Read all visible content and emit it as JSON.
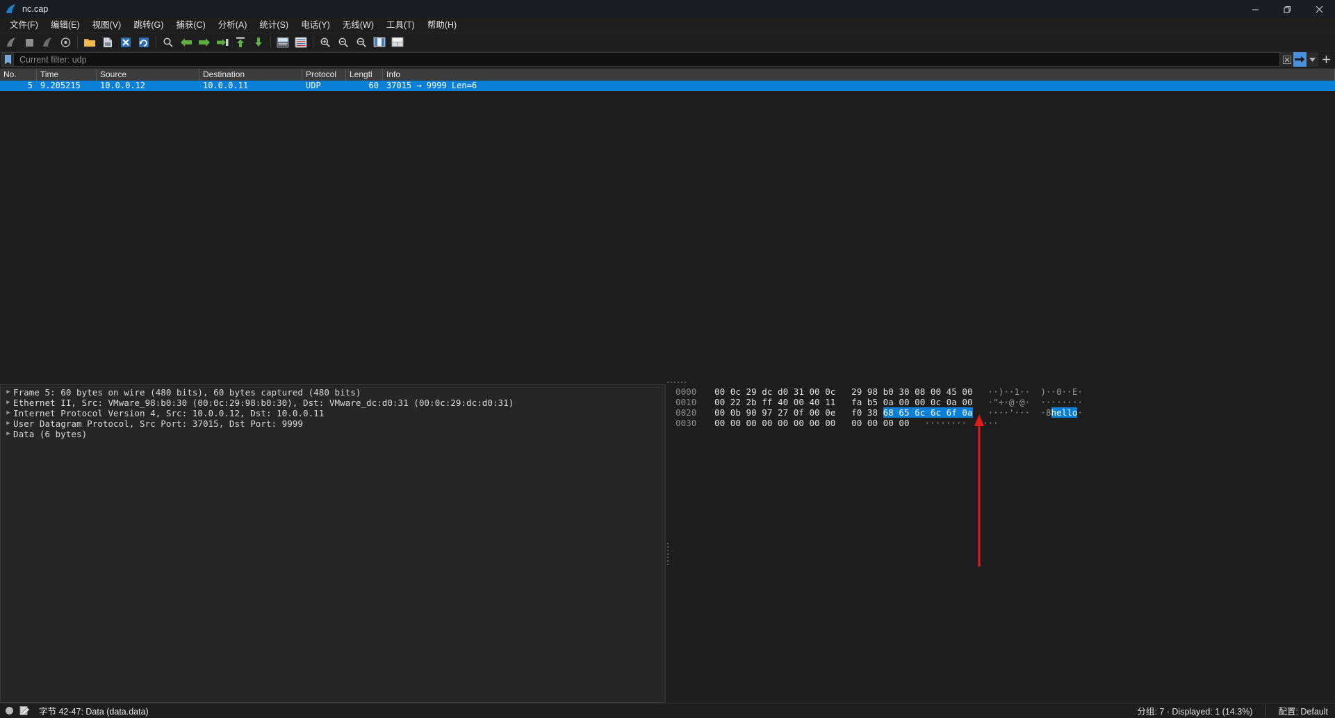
{
  "window": {
    "title": "nc.cap",
    "app_icon": "wireshark-fin-icon",
    "controls": {
      "minimize": "minimize-icon",
      "maximize": "restore-icon",
      "close": "close-icon"
    }
  },
  "menubar": {
    "items": [
      {
        "label": "文件(F)",
        "mnemonic": "F"
      },
      {
        "label": "编辑(E)",
        "mnemonic": "E"
      },
      {
        "label": "视图(V)",
        "mnemonic": "V"
      },
      {
        "label": "跳转(G)",
        "mnemonic": "G"
      },
      {
        "label": "捕获(C)",
        "mnemonic": "C"
      },
      {
        "label": "分析(A)",
        "mnemonic": "A"
      },
      {
        "label": "统计(S)",
        "mnemonic": "S"
      },
      {
        "label": "电话(Y)",
        "mnemonic": "Y"
      },
      {
        "label": "无线(W)",
        "mnemonic": "W"
      },
      {
        "label": "工具(T)",
        "mnemonic": "T"
      },
      {
        "label": "帮助(H)",
        "mnemonic": "H"
      }
    ]
  },
  "toolbar": {
    "buttons": [
      "start-capture-icon",
      "stop-capture-icon",
      "restart-capture-icon",
      "capture-options-icon",
      "open-file-icon",
      "save-file-icon",
      "close-file-icon",
      "reload-file-icon",
      "find-packet-icon",
      "go-back-icon",
      "go-forward-icon",
      "go-to-packet-icon",
      "go-to-first-icon",
      "go-to-last-icon",
      "colorize-icon",
      "auto-scroll-icon",
      "zoom-in-icon",
      "zoom-out-icon",
      "zoom-reset-icon",
      "resize-columns-icon",
      "layout-icon"
    ]
  },
  "filter": {
    "bookmark_icon": "filter-bookmark-icon",
    "value": "",
    "placeholder": "Current filter: udp",
    "clear_icon": "clear-filter-icon",
    "apply_icon": "apply-filter-icon",
    "history_icon": "filter-history-caret-icon",
    "add_icon": "add-filter-button-icon"
  },
  "packet_list": {
    "columns": [
      {
        "key": "no",
        "label": "No."
      },
      {
        "key": "time",
        "label": "Time"
      },
      {
        "key": "source",
        "label": "Source"
      },
      {
        "key": "destination",
        "label": "Destination"
      },
      {
        "key": "protocol",
        "label": "Protocol"
      },
      {
        "key": "length",
        "label": "Lengtl"
      },
      {
        "key": "info",
        "label": "Info"
      }
    ],
    "rows": [
      {
        "no": "5",
        "time": "9.205215",
        "source": "10.0.0.12",
        "destination": "10.0.0.11",
        "protocol": "UDP",
        "length": "60",
        "info": "37015 → 9999  Len=6",
        "selected": true
      }
    ]
  },
  "detail_tree": {
    "rows": [
      {
        "arrow": "collapsed-triangle-icon",
        "text": "Frame 5: 60 bytes on wire (480 bits), 60 bytes captured (480 bits)"
      },
      {
        "arrow": "collapsed-triangle-icon",
        "text": "Ethernet II, Src: VMware_98:b0:30 (00:0c:29:98:b0:30), Dst: VMware_dc:d0:31 (00:0c:29:dc:d0:31)"
      },
      {
        "arrow": "collapsed-triangle-icon",
        "text": "Internet Protocol Version 4, Src: 10.0.0.12, Dst: 10.0.0.11"
      },
      {
        "arrow": "collapsed-triangle-icon",
        "text": "User Datagram Protocol, Src Port: 37015, Dst Port: 9999"
      },
      {
        "arrow": "collapsed-triangle-icon",
        "text": "Data (6 bytes)"
      }
    ]
  },
  "hex_dump": {
    "rows": [
      {
        "offset": "0000",
        "bytes_pre": "00 0c 29 dc d0 31 00 0c   29 98 b0 30 08 00 45 00",
        "bytes_hl": "",
        "bytes_post": "",
        "ascii_pre": "··)··1··  )··0··E·",
        "ascii_hl": "",
        "ascii_post": ""
      },
      {
        "offset": "0010",
        "bytes_pre": "00 22 2b ff 40 00 40 11   fa b5 0a 00 00 0c 0a 00",
        "bytes_hl": "",
        "bytes_post": "",
        "ascii_pre": "·\"+·@·@·  ········",
        "ascii_hl": "",
        "ascii_post": ""
      },
      {
        "offset": "0020",
        "bytes_pre": "00 0b 90 97 27 0f 00 0e   f0 38 ",
        "bytes_hl": "68 65 6c 6c 6f 0a",
        "bytes_post": "",
        "ascii_pre": "····'···  ·8",
        "ascii_hl": "hello",
        "ascii_post": "·"
      },
      {
        "offset": "0030",
        "bytes_pre": "00 00 00 00 00 00 00 00   00 00 00 00",
        "bytes_hl": "",
        "bytes_post": "",
        "ascii_pre": "········  ····",
        "ascii_hl": "",
        "ascii_post": ""
      }
    ]
  },
  "annotation": {
    "type": "red-arrow",
    "color": "#e61919",
    "points_to": "hello"
  },
  "statusbar": {
    "expert_icon": "expert-info-icon",
    "capture_file_icon": "capture-file-properties-icon",
    "field_text": "字节 42-47: Data (data.data)",
    "packets_text": "分组: 7 · Displayed: 1 (14.3%)",
    "profile_text": "配置: Default"
  },
  "colors": {
    "selection_blue": "#0a7fd8",
    "window_bg": "#1e1e1e",
    "titlebar_bg": "#1b1d24",
    "header_bg": "#3c3c3c",
    "annotation_red": "#e61919"
  }
}
